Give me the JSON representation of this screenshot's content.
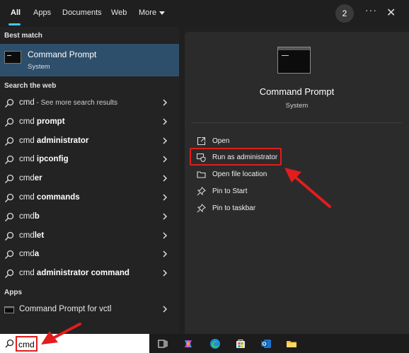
{
  "filters": {
    "tabs": [
      {
        "label": "All",
        "active": true
      },
      {
        "label": "Apps",
        "active": false
      },
      {
        "label": "Documents",
        "active": false
      },
      {
        "label": "Web",
        "active": false
      },
      {
        "label": "More",
        "active": false
      }
    ],
    "badge_count": "2",
    "more_options": "···",
    "close": "✕"
  },
  "left": {
    "best_match_heading": "Best match",
    "best_match": {
      "title": "Command Prompt",
      "subtitle": "System",
      "icon": "command-prompt-icon"
    },
    "web_heading": "Search the web",
    "web_results": [
      {
        "prefix": "cmd",
        "bold": "",
        "dim": " - See more search results"
      },
      {
        "prefix": "cmd ",
        "bold": "prompt",
        "dim": ""
      },
      {
        "prefix": "cmd ",
        "bold": "administrator",
        "dim": ""
      },
      {
        "prefix": "cmd ",
        "bold": "ipconfig",
        "dim": ""
      },
      {
        "prefix": "cmd",
        "bold": "er",
        "dim": ""
      },
      {
        "prefix": "cmd ",
        "bold": "commands",
        "dim": ""
      },
      {
        "prefix": "cmd",
        "bold": "b",
        "dim": ""
      },
      {
        "prefix": "cmd",
        "bold": "let",
        "dim": ""
      },
      {
        "prefix": "cmd",
        "bold": "a",
        "dim": ""
      },
      {
        "prefix": "cmd ",
        "bold": "administrator command",
        "dim": ""
      }
    ],
    "apps_heading": "Apps",
    "apps": [
      {
        "label": "Command Prompt for vctl",
        "icon": "command-prompt-icon"
      }
    ]
  },
  "right": {
    "title": "Command Prompt",
    "subtitle": "System",
    "actions": [
      {
        "label": "Open",
        "icon": "open-icon"
      },
      {
        "label": "Run as administrator",
        "icon": "shield-icon"
      },
      {
        "label": "Open file location",
        "icon": "folder-icon"
      },
      {
        "label": "Pin to Start",
        "icon": "pin-icon"
      },
      {
        "label": "Pin to taskbar",
        "icon": "pin-icon"
      }
    ]
  },
  "taskbar": {
    "search_value": "cmd",
    "apps": [
      "task-view-icon",
      "copilot-icon",
      "edge-icon",
      "store-icon",
      "outlook-icon",
      "file-explorer-icon"
    ]
  },
  "colors": {
    "accent": "#4cc2ff",
    "best_match_bg": "#2e4f6b",
    "annotation_red": "#e11d1d"
  }
}
